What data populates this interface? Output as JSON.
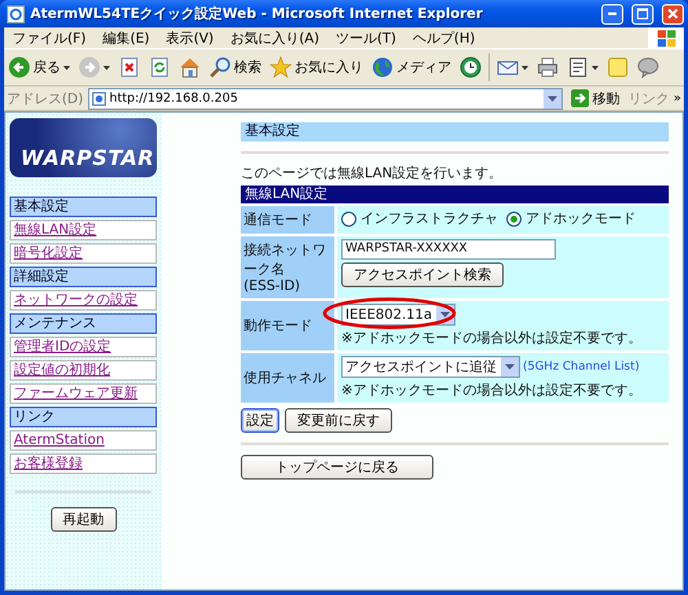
{
  "window": {
    "title": "AtermWL54TEクイック設定Web - Microsoft Internet Explorer"
  },
  "menu": [
    "ファイル(F)",
    "編集(E)",
    "表示(V)",
    "お気に入り(A)",
    "ツール(T)",
    "ヘルプ(H)"
  ],
  "toolbar": [
    {
      "kind": "back",
      "label": "戻る",
      "dropdown": true
    },
    {
      "kind": "forward",
      "dropdown": true
    },
    {
      "kind": "stop"
    },
    {
      "kind": "refresh"
    },
    {
      "kind": "home"
    },
    {
      "kind": "search",
      "label": "検索"
    },
    {
      "kind": "favorites",
      "label": "お気に入り"
    },
    {
      "kind": "media",
      "label": "メディア"
    },
    {
      "kind": "history"
    },
    {
      "kind": "mail",
      "dropdown": true
    },
    {
      "kind": "print"
    },
    {
      "kind": "edit",
      "dropdown": true
    },
    {
      "kind": "note"
    },
    {
      "kind": "messenger"
    }
  ],
  "address": {
    "label": "アドレス(D)",
    "url": "http://192.168.0.205",
    "go": "移動",
    "links": "リンク",
    "more": "»"
  },
  "sidebar": {
    "logo": "WARPSTAR",
    "sections": [
      {
        "title": "基本設定",
        "items": [
          "無線LAN設定",
          "暗号化設定"
        ]
      },
      {
        "title": "詳細設定",
        "items": [
          "ネットワークの設定"
        ]
      },
      {
        "title": "メンテナンス",
        "items": [
          "管理者IDの設定",
          "設定値の初期化",
          "ファームウェア更新"
        ]
      },
      {
        "title": "リンク",
        "items": [
          "AtermStation",
          "お客様登録"
        ]
      }
    ],
    "restart": "再起動"
  },
  "main": {
    "heading": "基本設定",
    "description": "このページでは無線LAN設定を行います。",
    "form": {
      "title": "無線LAN設定",
      "rows": [
        {
          "kind": "radio",
          "label": "通信モード",
          "options": [
            {
              "label": "インフラストラクチャ",
              "selected": false
            },
            {
              "label": "アドホックモード",
              "selected": true
            }
          ]
        },
        {
          "kind": "text",
          "label": "接続ネットワーク名",
          "sublabel": "(ESS-ID)",
          "value": "WARPSTAR-XXXXXX",
          "button": "アクセスポイント検索"
        },
        {
          "kind": "select",
          "label": "動作モード",
          "value": "IEEE802.11a",
          "circled": true,
          "note": "※アドホックモードの場合以外は設定不要です。"
        },
        {
          "kind": "select",
          "label": "使用チャネル",
          "value": "アクセスポイントに追従",
          "link": "(5GHz Channel List)",
          "note": "※アドホックモードの場合以外は設定不要です。"
        }
      ]
    },
    "buttons": [
      "設定",
      "変更前に戻す"
    ],
    "top_button": "トップページに戻る"
  }
}
